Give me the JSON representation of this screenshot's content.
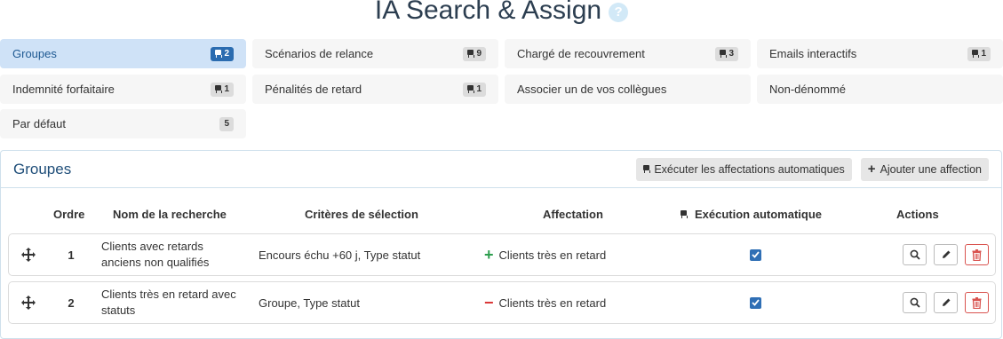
{
  "page": {
    "title": "IA Search & Assign",
    "help_icon": "?"
  },
  "tiles": [
    {
      "label": "Groupes",
      "count": "2",
      "robot": true,
      "active": true
    },
    {
      "label": "Scénarios de relance",
      "count": "9",
      "robot": true
    },
    {
      "label": "Chargé de recouvrement",
      "count": "3",
      "robot": true
    },
    {
      "label": "Emails interactifs",
      "count": "1",
      "robot": true
    },
    {
      "label": "Indemnité forfaitaire",
      "count": "1",
      "robot": true
    },
    {
      "label": "Pénalités de retard",
      "count": "1",
      "robot": true
    },
    {
      "label": "Associer un de vos collègues",
      "count": "",
      "robot": false
    },
    {
      "label": "Non-dénommé",
      "count": "",
      "robot": false
    },
    {
      "label": "Par défaut",
      "count": "5",
      "robot": false
    }
  ],
  "panel": {
    "title": "Groupes",
    "run_button": "Exécuter les affectations automatiques",
    "add_button": "Ajouter une affection"
  },
  "table": {
    "headers": {
      "order": "Ordre",
      "name": "Nom de la recherche",
      "criteria": "Critères de sélection",
      "assignment": "Affectation",
      "auto": "Exécution automatique",
      "actions": "Actions"
    },
    "rows": [
      {
        "order": "1",
        "name": "Clients avec retards anciens non qualifiés",
        "criteria": "Encours échu +60 j, Type statut",
        "sign": "plus",
        "assignment": "Clients très en retard",
        "auto": true
      },
      {
        "order": "2",
        "name": "Clients très en retard avec statuts",
        "criteria": "Groupe, Type statut",
        "sign": "minus",
        "assignment": "Clients très en retard",
        "auto": true
      }
    ]
  },
  "colors": {
    "accent": "#2f6fb5",
    "active_tile": "#cfe2f7",
    "plus": "#2e9e4f",
    "minus": "#d93535",
    "delete": "#d9534f"
  },
  "icons": [
    "help-icon",
    "robot-icon",
    "plus-icon",
    "move-icon",
    "search-icon",
    "edit-icon",
    "trash-icon",
    "checkbox-icon"
  ]
}
